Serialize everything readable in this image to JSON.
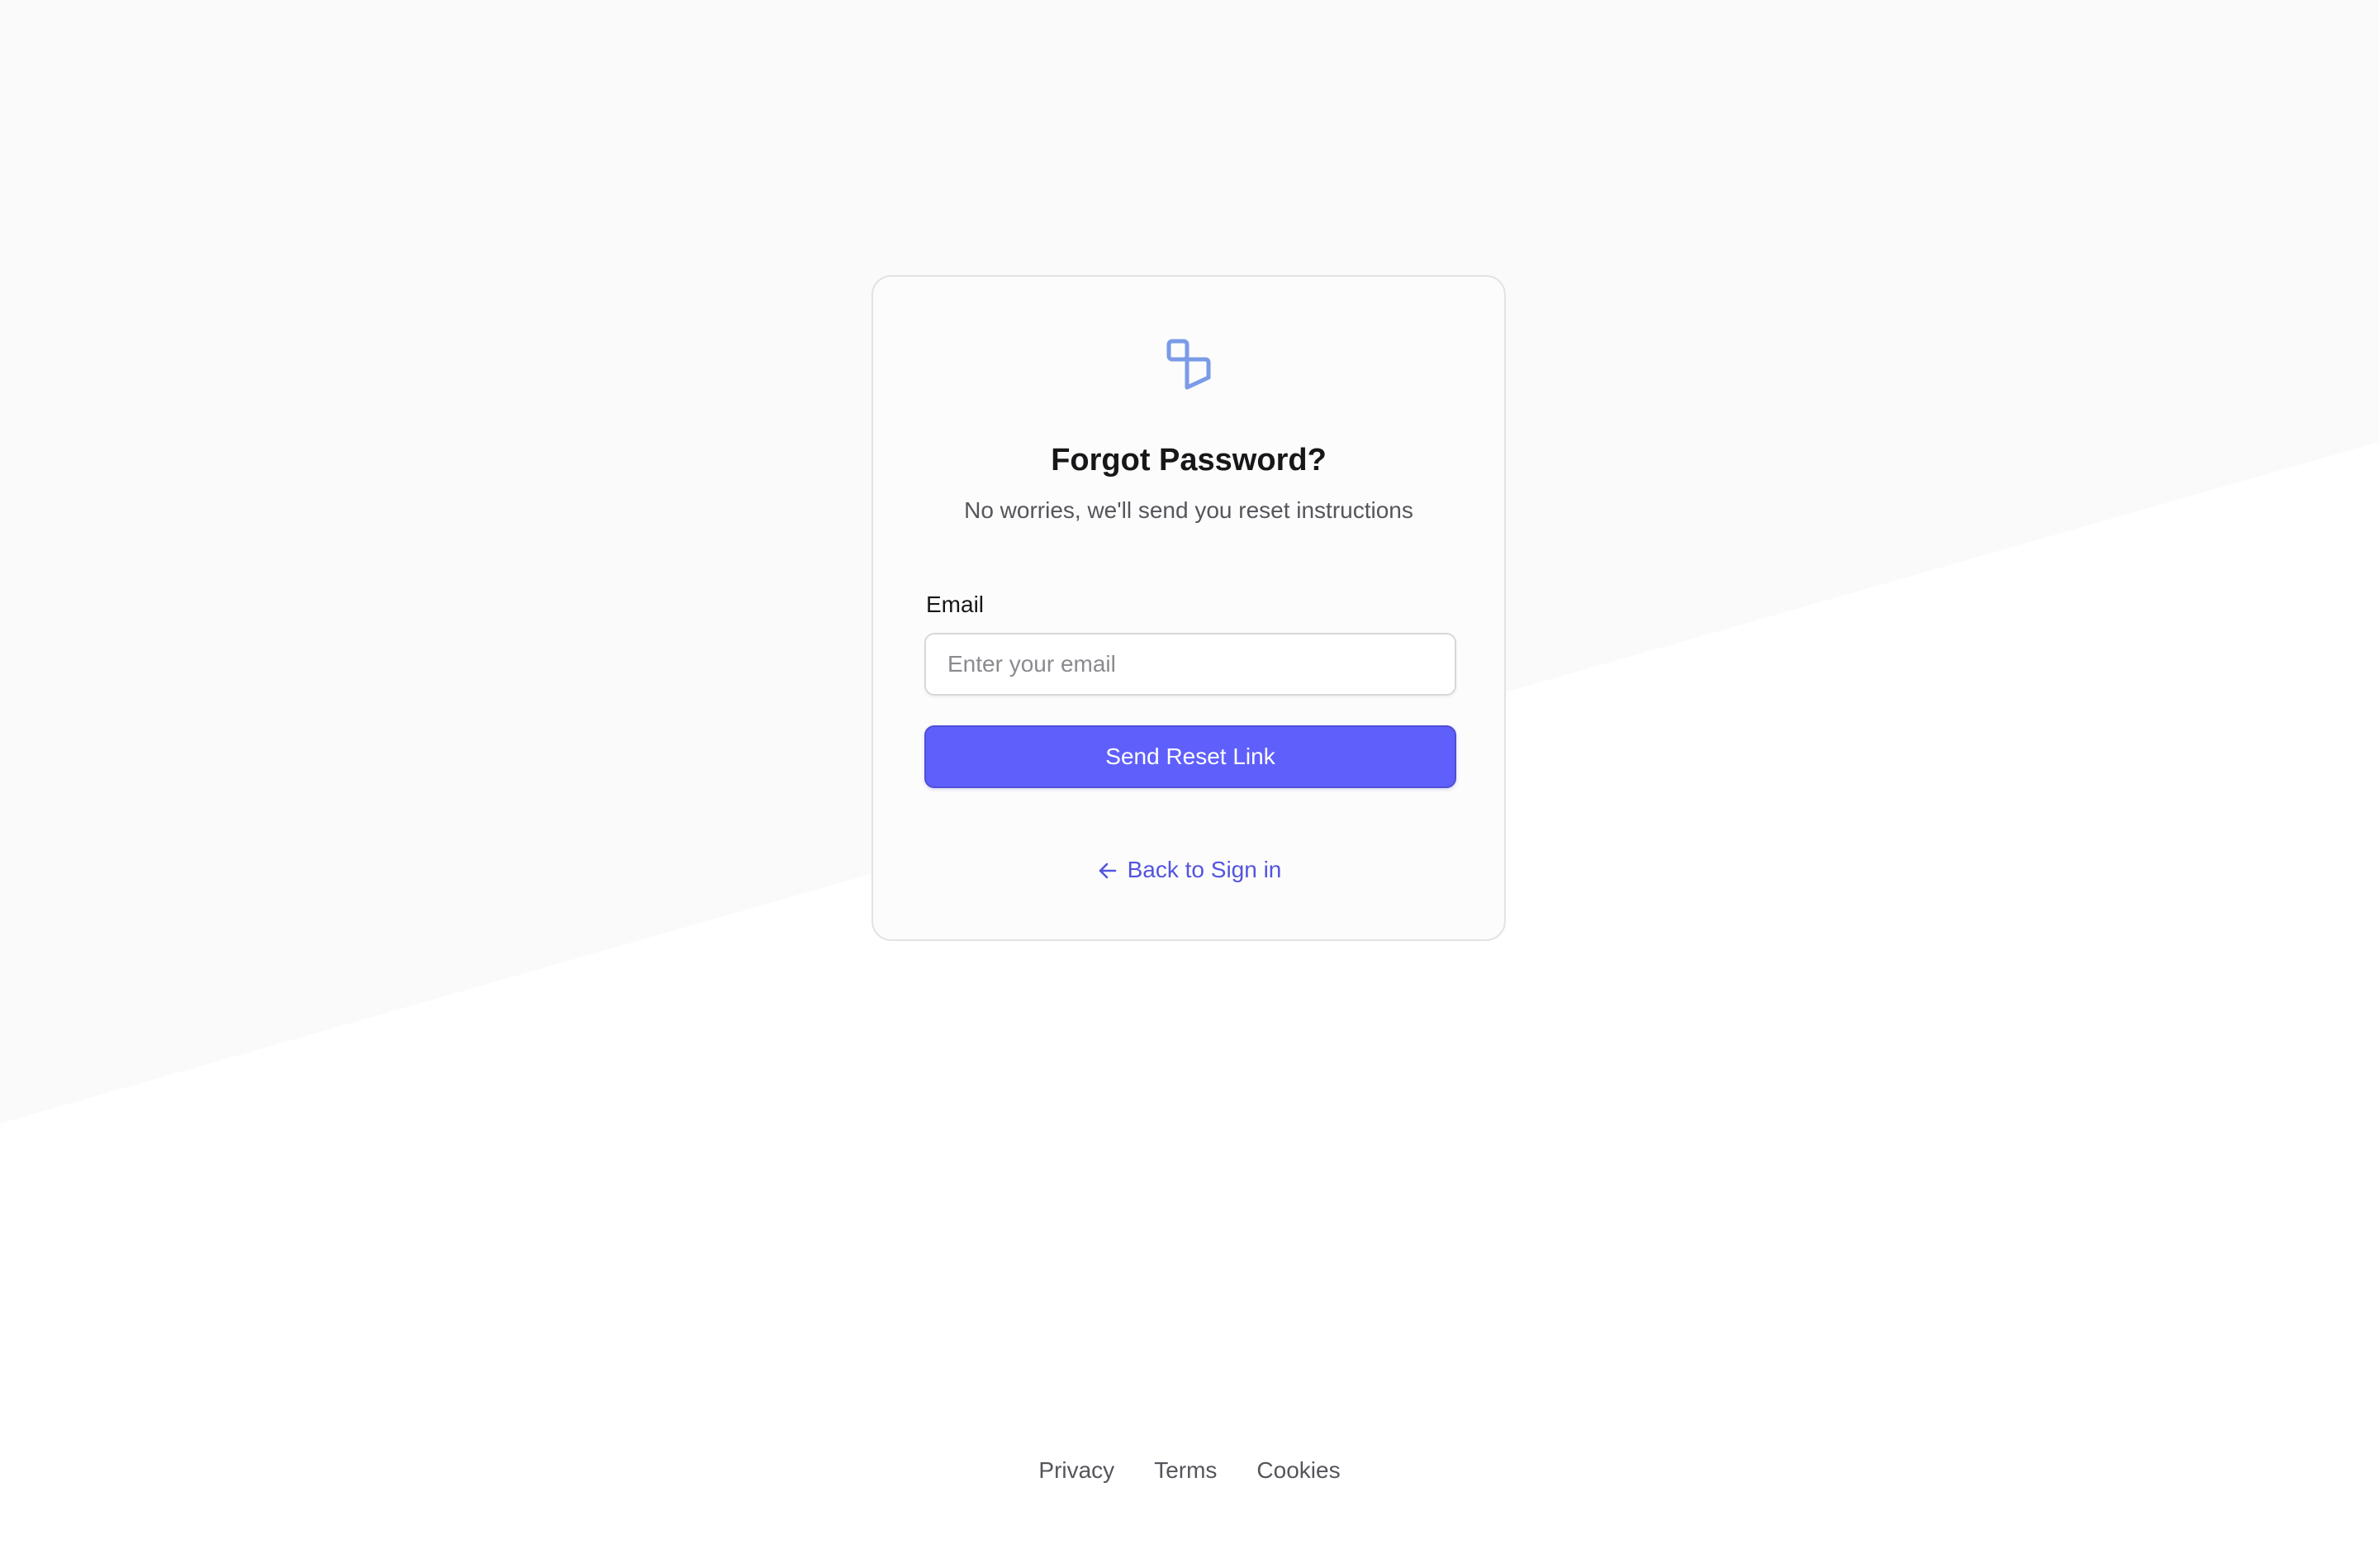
{
  "card": {
    "title": "Forgot Password?",
    "subtitle": "No worries, we'll send you reset instructions",
    "email_label": "Email",
    "email_placeholder": "Enter your email",
    "email_value": "",
    "submit_label": "Send Reset Link",
    "back_label": "Back to Sign in",
    "logo_icon": "brand-logo-icon",
    "back_icon": "arrow-left-icon"
  },
  "footer": {
    "links": [
      "Privacy",
      "Terms",
      "Cookies"
    ]
  },
  "colors": {
    "accent": "#5f5ffb",
    "link": "#5454df",
    "logo": "#7a9be8",
    "page_background": "#fafafa"
  }
}
